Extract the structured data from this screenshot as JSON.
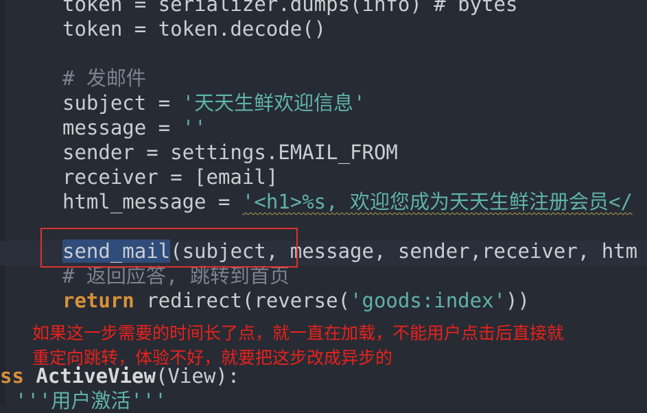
{
  "code": {
    "line_token_dumps": "token = serializer.dumps(info) # bytes",
    "line_token_decode": "token = token.decode()",
    "comment_send_mail": "# 发邮件",
    "subject_var": "subject = ",
    "subject_value": "'天天生鲜欢迎信息'",
    "message_var": "message = ",
    "message_value": "''",
    "sender_line": "sender = settings.EMAIL_FROM",
    "receiver_line": "receiver = [email]",
    "html_message_var": "html_message = ",
    "html_message_value": "'<h1>%s, 欢迎您成为天天生鲜注册会员</",
    "send_mail_func": "send_mail",
    "send_mail_args_a": "(subject, message, sender",
    "send_mail_args_b": ",receiver, htm",
    "comment_return": "# 返回应答, 跳转到首页",
    "return_kw": "return",
    "return_rest": " redirect(reverse(",
    "return_str": "'goods:index'",
    "return_end": "))",
    "class_kw": "ss",
    "class_name": " ActiveView",
    "class_rest": "(View):",
    "docstring": "'''用户激活'''"
  },
  "annotation": {
    "line1": "如果这一步需要的时间长了点，就一直在加载，不能用户点击后直接就",
    "line2": "重定向跳转，体验不好，就要把这步改成异步的"
  },
  "colors": {
    "background": "#272b34",
    "string": "#5fb3a8",
    "keyword": "#d8913a",
    "comment": "#7c828c",
    "highlight_box": "#e0322e",
    "annotation_text": "#e8221b"
  }
}
